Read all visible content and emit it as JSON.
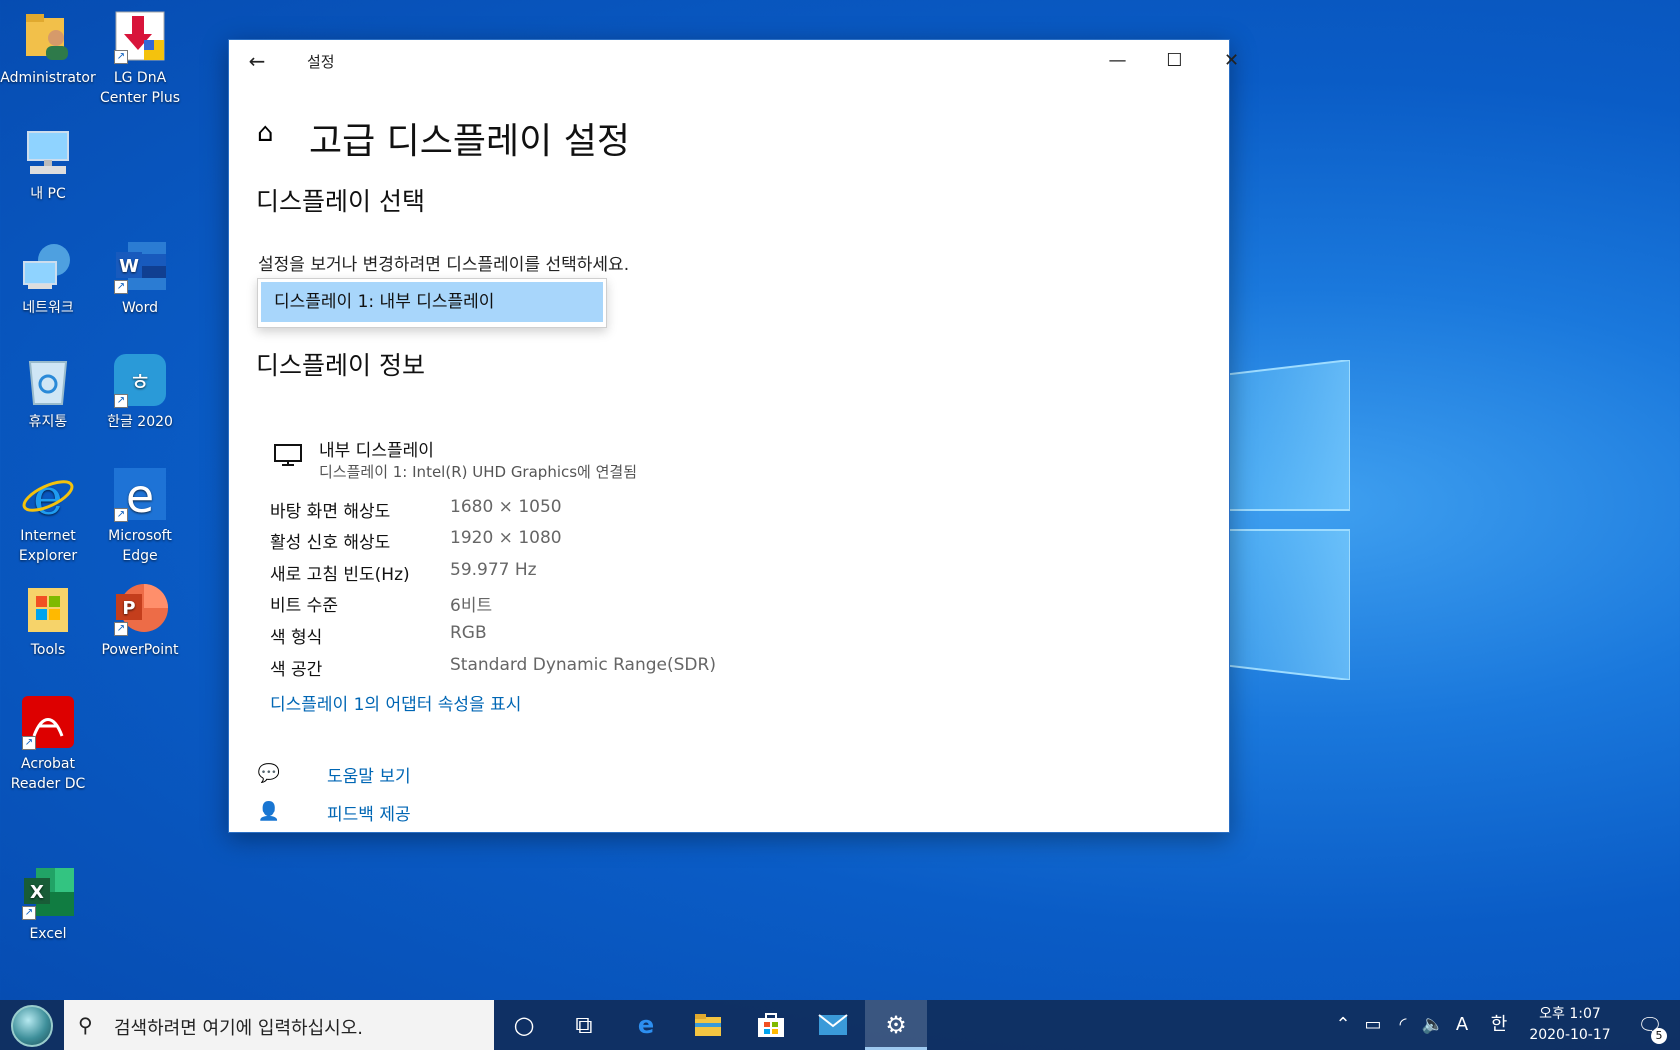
{
  "desktop": {
    "icons": [
      {
        "label": "Administrator"
      },
      {
        "label": "LG DnA Center Plus"
      },
      {
        "label": "내 PC"
      },
      {
        "label": "네트워크"
      },
      {
        "label": "Word"
      },
      {
        "label": "휴지통"
      },
      {
        "label": "한글 2020"
      },
      {
        "label": "Internet Explorer"
      },
      {
        "label": "Microsoft Edge"
      },
      {
        "label": "Tools"
      },
      {
        "label": "PowerPoint"
      },
      {
        "label": "Acrobat Reader DC"
      },
      {
        "label": "Excel"
      }
    ]
  },
  "window": {
    "title": "설정",
    "page_title": "고급 디스플레이 설정",
    "select_section": {
      "heading": "디스플레이 선택",
      "description": "설정을 보거나 변경하려면 디스플레이를 선택하세요.",
      "selected_option": "디스플레이 1: 내부 디스플레이"
    },
    "info_section": {
      "heading": "디스플레이 정보",
      "monitor_name": "내부 디스플레이",
      "monitor_sub": "디스플레이 1: Intel(R) UHD Graphics에 연결됨",
      "rows": [
        {
          "label": "바탕 화면 해상도",
          "value": "1680 × 1050"
        },
        {
          "label": "활성 신호 해상도",
          "value": "1920 × 1080"
        },
        {
          "label": "새로 고침 빈도(Hz)",
          "value": "59.977 Hz"
        },
        {
          "label": "비트 수준",
          "value": "6비트"
        },
        {
          "label": "색 형식",
          "value": "RGB"
        },
        {
          "label": "색 공간",
          "value": "Standard Dynamic Range(SDR)"
        }
      ],
      "adapter_link": "디스플레이 1의 어댑터 속성을 표시"
    },
    "help_link": "도움말 보기",
    "feedback_link": "피드백 제공"
  },
  "taskbar": {
    "search_placeholder": "검색하려면 여기에 입력하십시오.",
    "ime_a": "A",
    "ime_han": "한",
    "clock_time": "오후 1:07",
    "clock_date": "2020-10-17",
    "notification_count": "5"
  },
  "colors": {
    "accent": "#0066b4",
    "dropdown_selected": "#a8d6fb"
  }
}
